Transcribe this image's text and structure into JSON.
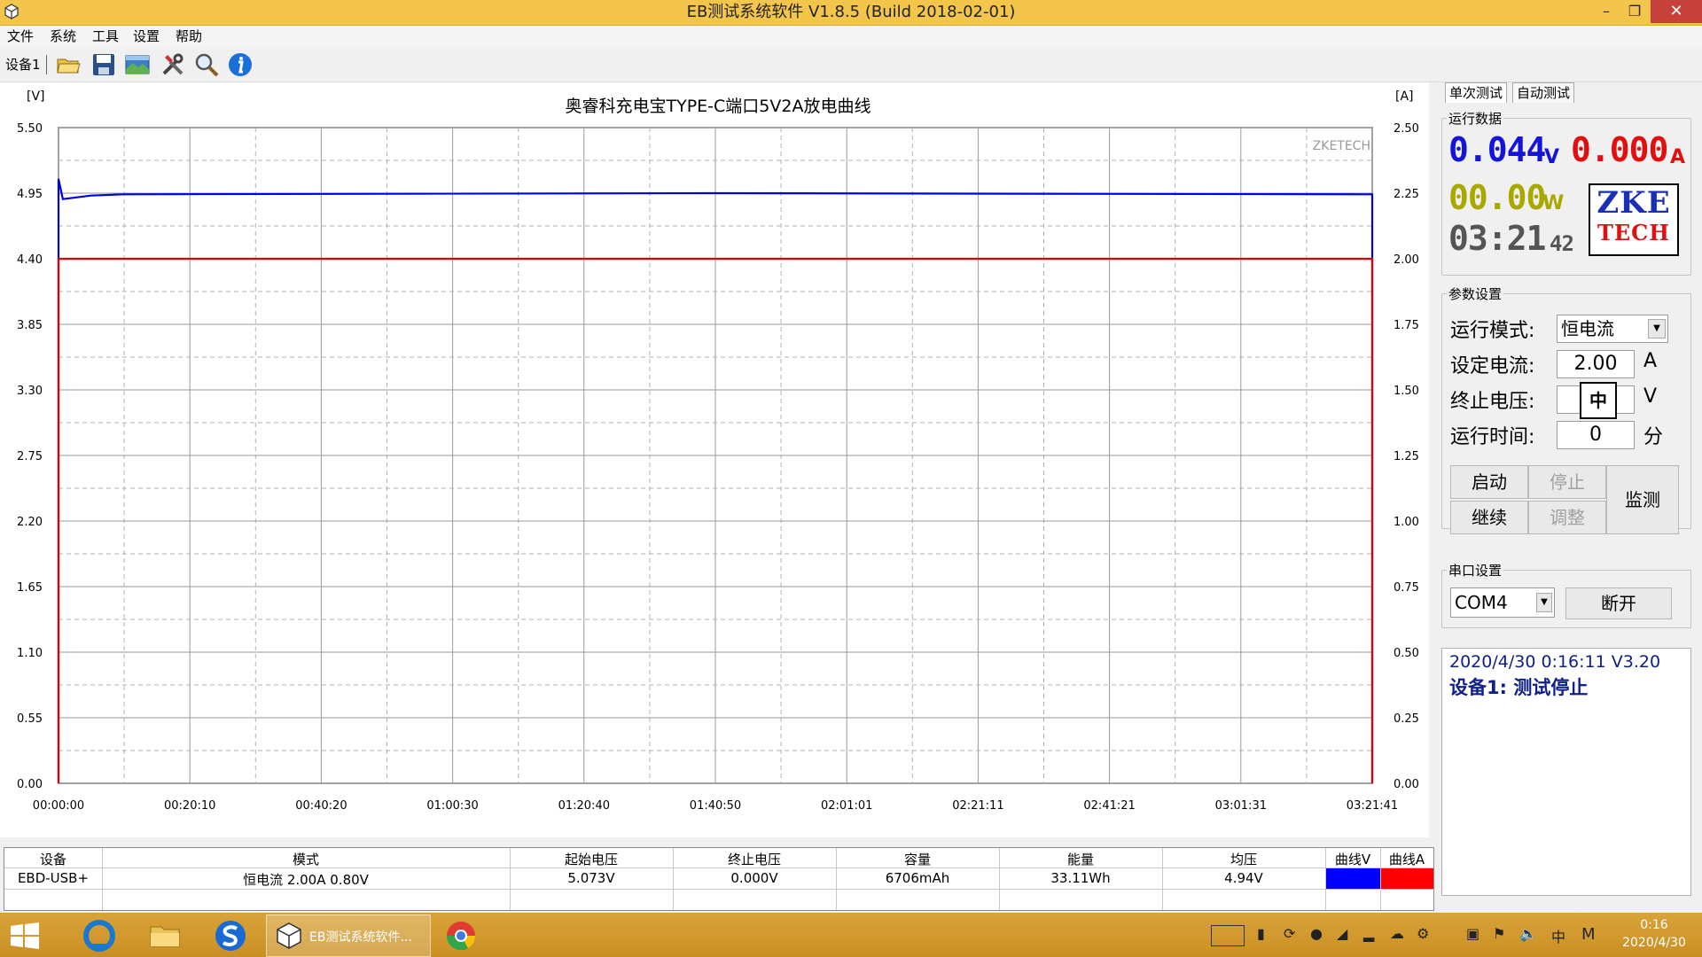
{
  "window": {
    "title": "EB测试系统软件 V1.8.5 (Build 2018-02-01)",
    "controls": {
      "minimize": "–",
      "maximize": "❐",
      "close": "✕"
    }
  },
  "menu": [
    "文件",
    "系统",
    "工具",
    "设置",
    "帮助"
  ],
  "toolbar": {
    "device_tab": "设备1",
    "icons": [
      "folder-open-icon",
      "save-icon",
      "image-export-icon",
      "tools-icon",
      "search-icon",
      "info-icon"
    ]
  },
  "chart_data": {
    "type": "line",
    "title": "奥睿科充电宝TYPE-C端口5V2A放电曲线",
    "left_unit": "[V]",
    "right_unit": "[A]",
    "watermark": "ZKETECH",
    "y_left_ticks": [
      "5.50",
      "4.95",
      "4.40",
      "3.85",
      "3.30",
      "2.75",
      "2.20",
      "1.65",
      "1.10",
      "0.55",
      "0.00"
    ],
    "y_right_ticks": [
      "2.50",
      "2.25",
      "2.00",
      "1.75",
      "1.50",
      "1.25",
      "1.00",
      "0.75",
      "0.50",
      "0.25",
      "0.00"
    ],
    "x_ticks": [
      "00:00:00",
      "00:20:10",
      "00:40:20",
      "01:00:30",
      "01:20:40",
      "01:40:50",
      "02:01:01",
      "02:21:11",
      "02:41:21",
      "03:01:31",
      "03:21:41"
    ],
    "y_left_range": [
      0,
      5.5
    ],
    "y_right_range": [
      0,
      2.5
    ],
    "x_range_seconds": [
      0,
      12101
    ],
    "grid": true,
    "series": [
      {
        "axis": "left",
        "color": "#0000e0",
        "points": [
          [
            0,
            0
          ],
          [
            0,
            5.07
          ],
          [
            40,
            4.9
          ],
          [
            300,
            4.93
          ],
          [
            600,
            4.94
          ],
          [
            6000,
            4.95
          ],
          [
            12000,
            4.94
          ],
          [
            12101,
            4.94
          ],
          [
            12101,
            0
          ]
        ]
      },
      {
        "axis": "right",
        "color": "#e00000",
        "points": [
          [
            0,
            0
          ],
          [
            0,
            2.0
          ],
          [
            12101,
            2.0
          ],
          [
            12101,
            0
          ]
        ]
      }
    ]
  },
  "table": {
    "headers": [
      "设备",
      "模式",
      "起始电压",
      "终止电压",
      "容量",
      "能量",
      "均压",
      "曲线V",
      "曲线A"
    ],
    "row": [
      "EBD-USB+",
      "恒电流  2.00A  0.80V",
      "5.073V",
      "0.000V",
      "6706mAh",
      "33.11Wh",
      "4.94V"
    ],
    "curve_colors": [
      "#0000ff",
      "#ff0000"
    ]
  },
  "right_panel": {
    "tabs": [
      "单次测试",
      "自动测试"
    ],
    "run_data": {
      "label": "运行数据",
      "voltage": "0.044",
      "voltage_unit": "V",
      "current": "0.000",
      "current_unit": "A",
      "power": "00.00",
      "power_unit": "W",
      "time": "03:21",
      "time_seconds": "42",
      "logo_line1": "ZKE",
      "logo_line2": "TECH",
      "colors": {
        "voltage": "#1414d8",
        "current": "#e01010",
        "power": "#a8a800",
        "time": "#555555"
      }
    },
    "params": {
      "label": "参数设置",
      "mode_label": "运行模式:",
      "mode_value": "恒电流",
      "current_label": "设定电流:",
      "current_value": "2.00",
      "current_unit": "A",
      "cutoff_label": "终止电压:",
      "cutoff_value": "",
      "cutoff_unit": "V",
      "ime_indicator": "中",
      "time_label": "运行时间:",
      "time_value": "0",
      "time_unit": "分",
      "buttons": {
        "start": "启动",
        "stop": "停止",
        "continue": "继续",
        "adjust": "调整",
        "monitor": "监测"
      }
    },
    "serial": {
      "label": "串口设置",
      "port": "COM4",
      "disconnect": "断开"
    },
    "status": {
      "line1": "2020/4/30 0:16:11  V3.20",
      "line2": "设备1: 测试停止"
    }
  },
  "taskbar": {
    "active_task": "EB测试系统软件...",
    "clock_time": "0:16",
    "clock_date": "2020/4/30",
    "ime": "中",
    "ime_mode": "M"
  }
}
